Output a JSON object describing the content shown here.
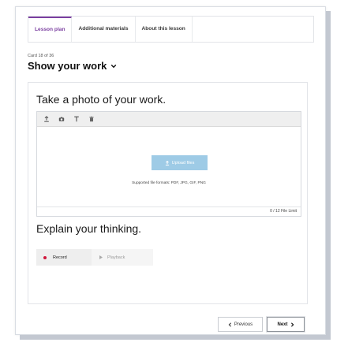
{
  "tabs": [
    {
      "label": "Lesson plan",
      "active": true
    },
    {
      "label": "Additional materials",
      "active": false
    },
    {
      "label": "About this lesson",
      "active": false
    }
  ],
  "card": {
    "counter": "Card 18 of 36",
    "title": "Show your work"
  },
  "photo_section": {
    "heading": "Take a photo of your work.",
    "toolbar_icons": [
      "upload-icon",
      "camera-icon",
      "text-icon",
      "trash-icon"
    ],
    "upload_label": "Upload files",
    "formats_text": "Supported file formats: PDF, JPG, GIF, PNG",
    "file_limit": "0 / 12 File Limit"
  },
  "thinking_section": {
    "heading": "Explain your thinking.",
    "record_label": "Record",
    "playback_label": "Playback"
  },
  "navigation": {
    "previous_label": "Previous",
    "next_label": "Next"
  },
  "colors": {
    "accent": "#7b3fa0",
    "upload_button": "#9ecbe6",
    "record_dot": "#d0163c"
  }
}
